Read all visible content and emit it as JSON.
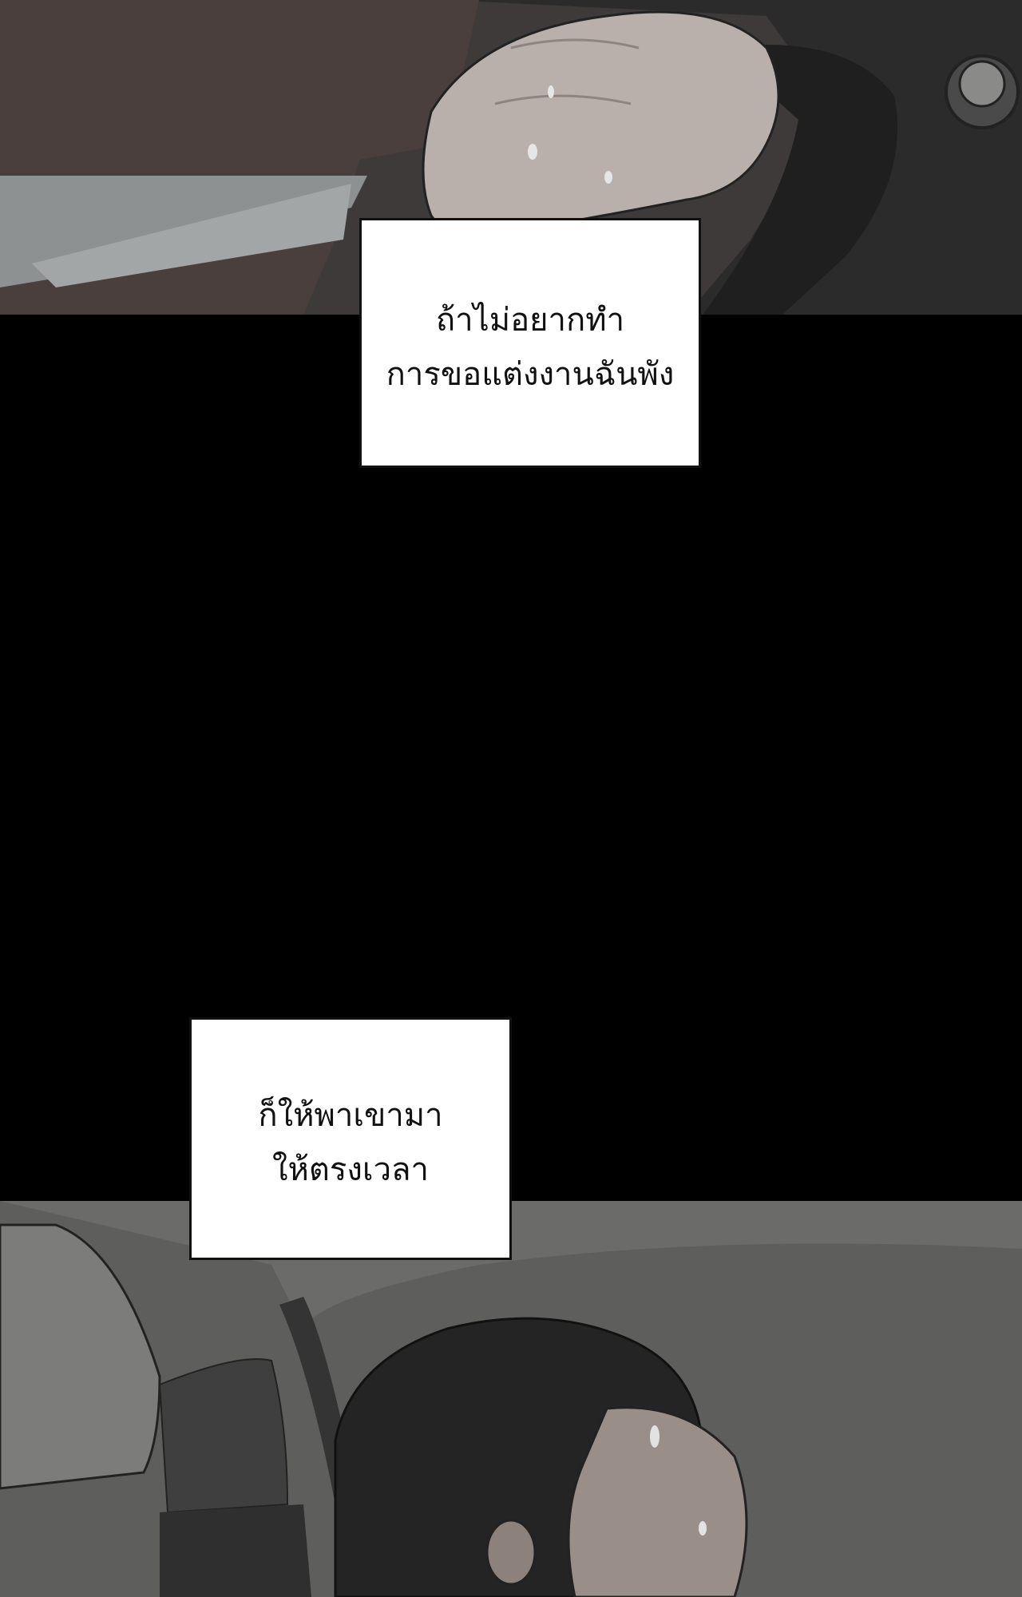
{
  "panels": [
    {
      "scene": "hand-on-steering-wheel"
    },
    {
      "scene": "black-transition"
    },
    {
      "scene": "man-sweating-in-car"
    }
  ],
  "captions": [
    {
      "lines": [
        "ถ้าไม่อยากทำ",
        "การขอแต่งงานฉันพัง"
      ]
    },
    {
      "lines": [
        "ก็ให้พาเขามา",
        "ให้ตรงเวลา"
      ]
    }
  ]
}
